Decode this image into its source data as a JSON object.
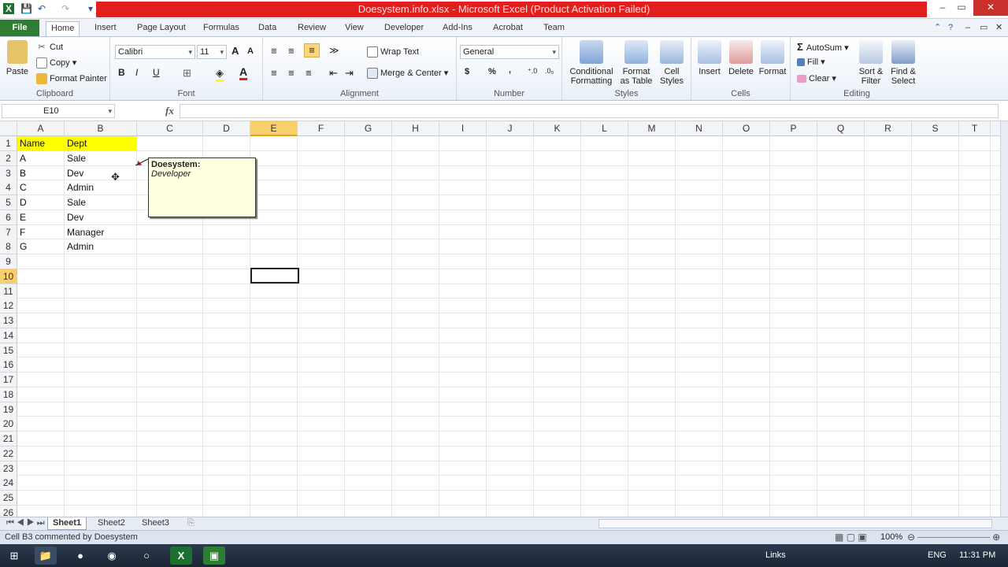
{
  "window": {
    "title": "Doesystem.info.xlsx  -  Microsoft Excel (Product Activation Failed)",
    "controls": [
      "–",
      "▭",
      "✕"
    ]
  },
  "tabs": [
    "File",
    "Home",
    "Insert",
    "Page Layout",
    "Formulas",
    "Data",
    "Review",
    "View",
    "Developer",
    "Add-Ins",
    "Acrobat",
    "Team"
  ],
  "ribbon": {
    "clipboard": {
      "label": "Clipboard",
      "paste": "Paste",
      "cut": "Cut",
      "copy": "Copy",
      "format_painter": "Format Painter"
    },
    "font": {
      "label": "Font",
      "name": "Calibri",
      "size": "11",
      "bold": "B",
      "italic": "I",
      "underline": "U"
    },
    "alignment": {
      "label": "Alignment",
      "wrap_text": "Wrap Text",
      "merge_center": "Merge & Center"
    },
    "number": {
      "label": "Number",
      "format": "General",
      "currency": "$",
      "percent": "%",
      "comma": ","
    },
    "styles": {
      "label": "Styles",
      "conditional": "Conditional Formatting",
      "format_table": "Format as Table",
      "cell_styles": "Cell Styles"
    },
    "cells": {
      "label": "Cells",
      "insert": "Insert",
      "delete": "Delete",
      "format": "Format"
    },
    "editing": {
      "label": "Editing",
      "autosum": "AutoSum",
      "fill": "Fill",
      "clear": "Clear",
      "sort_filter": "Sort & Filter",
      "find_select": "Find & Select"
    }
  },
  "formula_bar": {
    "name_box": "E10",
    "fx": "fx",
    "content": ""
  },
  "columns": [
    "A",
    "B",
    "C",
    "D",
    "E",
    "F",
    "G",
    "H",
    "I",
    "J",
    "K",
    "L",
    "M",
    "N",
    "O",
    "P",
    "Q",
    "R",
    "S",
    "T"
  ],
  "rows": [
    "1",
    "2",
    "3",
    "4",
    "5",
    "6",
    "7",
    "8",
    "9",
    "10",
    "11",
    "12",
    "13",
    "14",
    "15",
    "16",
    "17",
    "18",
    "19",
    "20",
    "21",
    "22",
    "23",
    "24",
    "25",
    "26"
  ],
  "cells": {
    "A": [
      "Name",
      "A",
      "B",
      "C",
      "D",
      "E",
      "F",
      "G"
    ],
    "B": [
      "Dept",
      "Sale",
      "Dev",
      "Admin",
      "Sale",
      "Dev",
      "Manager",
      "Admin"
    ]
  },
  "comment": {
    "author": "Doesystem:",
    "text": "Developer"
  },
  "sheets": [
    "Sheet1",
    "Sheet2",
    "Sheet3"
  ],
  "status": {
    "message": "Cell B3 commented by Doesystem",
    "zoom": "100%"
  },
  "taskbar": {
    "links": "Links",
    "lang": "ENG",
    "time": "11:31 PM"
  },
  "colors": {
    "header_fill": "#ffff00",
    "accent": "#2f7d32",
    "title_bar": "#e11f1f",
    "selected_header": "#f8cf6a"
  }
}
